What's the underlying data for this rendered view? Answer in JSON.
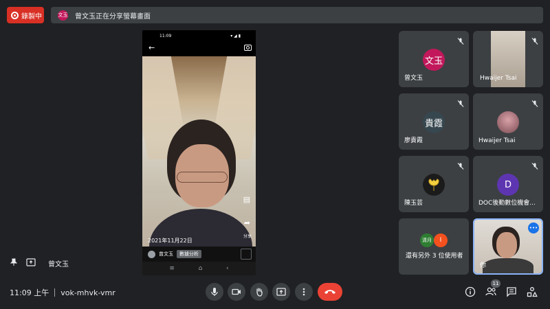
{
  "recording": {
    "label": "錄製中"
  },
  "share_banner": {
    "avatar_text": "文玉",
    "text": "曾文玉正在分享螢幕畫面"
  },
  "phone": {
    "status_time": "11:09",
    "date_text": "2021年11月22日",
    "share_label": "分享",
    "uploader_name": "曾文玉",
    "tag": "數據分析"
  },
  "tiles": [
    {
      "name": "曾文玉",
      "avatar_text": "文玉",
      "avatar_color": "#c2185b"
    },
    {
      "name": "Hwaijer Tsai"
    },
    {
      "name": "廖貴霞",
      "avatar_text": "貴霞",
      "avatar_color": "#37474f"
    },
    {
      "name": "Hwaijer Tsai"
    },
    {
      "name": "陳玉芸"
    },
    {
      "name": "DOC後勤數位機會...",
      "avatar_text": "D",
      "avatar_color": "#5e35b1"
    },
    {
      "name": "還有另外 3 位使用者",
      "avatar_text_1": "清月",
      "avatar_text_2": "I"
    },
    {
      "name": "你"
    }
  ],
  "presenter": {
    "name": "曾文玉"
  },
  "meeting": {
    "time": "11:09 上午",
    "code": "vok-mhvk-vmr"
  },
  "people_count": "11",
  "colors": {
    "accent": "#1a73e8",
    "end_call": "#ea4335",
    "recording": "#d93025"
  }
}
